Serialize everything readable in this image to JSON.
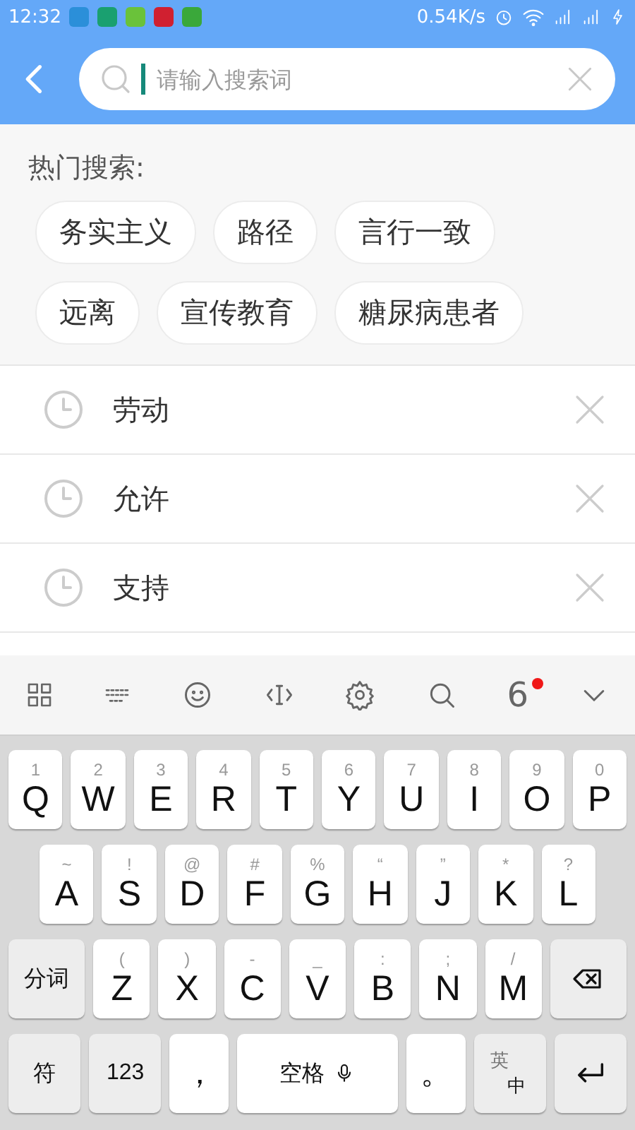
{
  "status_bar": {
    "time": "12:32",
    "speed": "0.54K/s"
  },
  "search": {
    "placeholder": "请输入搜索词"
  },
  "hot_search": {
    "title": "热门搜索:",
    "tags": [
      "务实主义",
      "路径",
      "言行一致",
      "远离",
      "宣传教育",
      "糖尿病患者"
    ]
  },
  "history": [
    {
      "text": "劳动"
    },
    {
      "text": "允许"
    },
    {
      "text": "支持"
    }
  ],
  "keyboard": {
    "candidate": "6",
    "candidate_badge": true,
    "row_1": [
      {
        "kind": "letter",
        "label": "Q",
        "sub": "1"
      },
      {
        "kind": "letter",
        "label": "W",
        "sub": "2"
      },
      {
        "kind": "letter",
        "label": "E",
        "sub": "3"
      },
      {
        "kind": "letter",
        "label": "R",
        "sub": "4"
      },
      {
        "kind": "letter",
        "label": "T",
        "sub": "5"
      },
      {
        "kind": "letter",
        "label": "Y",
        "sub": "6"
      },
      {
        "kind": "letter",
        "label": "U",
        "sub": "7"
      },
      {
        "kind": "letter",
        "label": "I",
        "sub": "8"
      },
      {
        "kind": "letter",
        "label": "O",
        "sub": "9"
      },
      {
        "kind": "letter",
        "label": "P",
        "sub": "0"
      }
    ],
    "row_2": [
      {
        "kind": "letter",
        "label": "A",
        "sub": "~"
      },
      {
        "kind": "letter",
        "label": "S",
        "sub": "!"
      },
      {
        "kind": "letter",
        "label": "D",
        "sub": "@"
      },
      {
        "kind": "letter",
        "label": "F",
        "sub": "#"
      },
      {
        "kind": "letter",
        "label": "G",
        "sub": "%"
      },
      {
        "kind": "letter",
        "label": "H",
        "sub": "“"
      },
      {
        "kind": "letter",
        "label": "J",
        "sub": "”"
      },
      {
        "kind": "letter",
        "label": "K",
        "sub": "*"
      },
      {
        "kind": "letter",
        "label": "L",
        "sub": "?"
      }
    ],
    "row_3": [
      {
        "kind": "func",
        "label": "分词"
      },
      {
        "kind": "letter",
        "label": "Z",
        "sub": "("
      },
      {
        "kind": "letter",
        "label": "X",
        "sub": ")"
      },
      {
        "kind": "letter",
        "label": "C",
        "sub": "-"
      },
      {
        "kind": "letter",
        "label": "V",
        "sub": "_"
      },
      {
        "kind": "letter",
        "label": "B",
        "sub": ":"
      },
      {
        "kind": "letter",
        "label": "N",
        "sub": ";"
      },
      {
        "kind": "letter",
        "label": "M",
        "sub": "/"
      },
      {
        "kind": "backspace"
      }
    ],
    "bottom_row": [
      {
        "kind": "func",
        "label": "符"
      },
      {
        "kind": "func",
        "label": "123"
      },
      {
        "kind": "punct",
        "label": "，"
      },
      {
        "kind": "space",
        "label": "空格"
      },
      {
        "kind": "punct",
        "label": "。"
      },
      {
        "kind": "lang",
        "label": "英",
        "sub": "中"
      },
      {
        "kind": "enter"
      }
    ]
  }
}
